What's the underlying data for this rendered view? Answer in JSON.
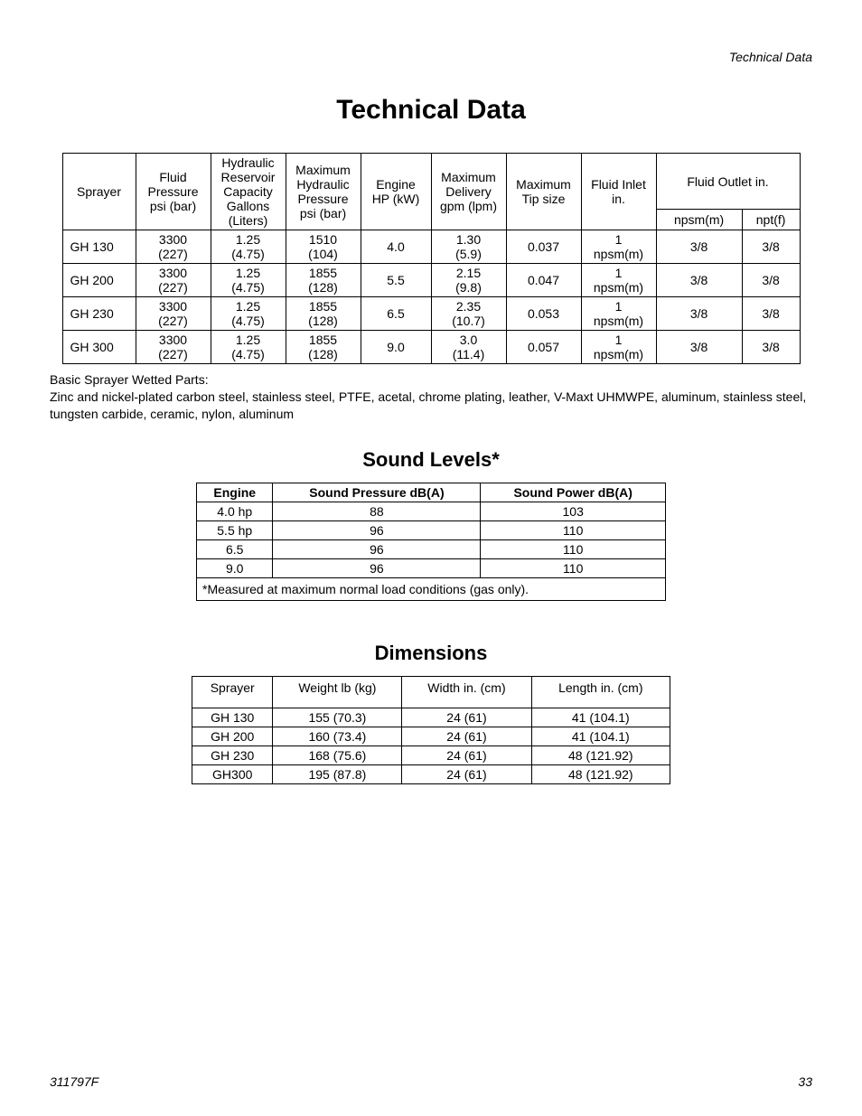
{
  "running_head": "Technical Data",
  "title": "Technical Data",
  "tech_table": {
    "headers": {
      "sprayer": "Sprayer",
      "fluid_pressure": "Fluid Pressure psi (bar)",
      "reservoir": "Hydraulic Reservoir Capacity Gallons (Liters)",
      "max_hyd": "Maximum Hydraulic Pressure psi (bar)",
      "engine": "Engine HP (kW)",
      "max_delivery": "Maximum Delivery gpm (lpm)",
      "tip": "Maximum Tip size",
      "inlet": "Fluid Inlet in.",
      "outlet": "Fluid Outlet in.",
      "outlet_sub_a": "npsm(m)",
      "outlet_sub_b": "npt(f)"
    },
    "rows": [
      {
        "model": "GH 130",
        "fp_a": "3300",
        "fp_b": "(227)",
        "res_a": "1.25",
        "res_b": "(4.75)",
        "mh_a": "1510",
        "mh_b": "(104)",
        "eng": "4.0",
        "md_a": "1.30",
        "md_b": "(5.9)",
        "tip": "0.037",
        "in_a": "1",
        "in_b": "npsm(m)",
        "out_a": "3/8",
        "out_b": "3/8"
      },
      {
        "model": "GH 200",
        "fp_a": "3300",
        "fp_b": "(227)",
        "res_a": "1.25",
        "res_b": "(4.75)",
        "mh_a": "1855",
        "mh_b": "(128)",
        "eng": "5.5",
        "md_a": "2.15",
        "md_b": "(9.8)",
        "tip": "0.047",
        "in_a": "1",
        "in_b": "npsm(m)",
        "out_a": "3/8",
        "out_b": "3/8"
      },
      {
        "model": "GH 230",
        "fp_a": "3300",
        "fp_b": "(227)",
        "res_a": "1.25",
        "res_b": "(4.75)",
        "mh_a": "1855",
        "mh_b": "(128)",
        "eng": "6.5",
        "md_a": "2.35",
        "md_b": "(10.7)",
        "tip": "0.053",
        "in_a": "1",
        "in_b": "npsm(m)",
        "out_a": "3/8",
        "out_b": "3/8"
      },
      {
        "model": "GH 300",
        "fp_a": "3300",
        "fp_b": "(227)",
        "res_a": "1.25",
        "res_b": "(4.75)",
        "mh_a": "1855",
        "mh_b": "(128)",
        "eng": "9.0",
        "md_a": "3.0",
        "md_b": "(11.4)",
        "tip": "0.057",
        "in_a": "1",
        "in_b": "npsm(m)",
        "out_a": "3/8",
        "out_b": "3/8"
      }
    ]
  },
  "wetted_heading": "Basic Sprayer Wetted Parts:",
  "wetted_body": "Zinc and nickel-plated carbon steel, stainless steel, PTFE, acetal, chrome plating, leather, V-Maxt UHMWPE, aluminum, stainless steel, tungsten carbide, ceramic, nylon, aluminum",
  "sound": {
    "title": "Sound Levels*",
    "headers": {
      "engine": "Engine",
      "pressure": "Sound Pressure dB(A)",
      "power": "Sound Power dB(A)"
    },
    "rows": [
      {
        "engine": "4.0 hp",
        "pressure": "88",
        "power": "103"
      },
      {
        "engine": "5.5 hp",
        "pressure": "96",
        "power": "110"
      },
      {
        "engine": "6.5",
        "pressure": "96",
        "power": "110"
      },
      {
        "engine": "9.0",
        "pressure": "96",
        "power": "110"
      }
    ],
    "note": "*Measured at maximum normal load conditions (gas only)."
  },
  "dimensions": {
    "title": "Dimensions",
    "headers": {
      "sprayer": "Sprayer",
      "weight": "Weight lb (kg)",
      "width": "Width in. (cm)",
      "length": "Length in. (cm)"
    },
    "rows": [
      {
        "sprayer": "GH 130",
        "weight": "155 (70.3)",
        "width": "24 (61)",
        "length": "41 (104.1)"
      },
      {
        "sprayer": "GH 200",
        "weight": "160 (73.4)",
        "width": "24 (61)",
        "length": "41 (104.1)"
      },
      {
        "sprayer": "GH 230",
        "weight": "168 (75.6)",
        "width": "24 (61)",
        "length": "48 (121.92)"
      },
      {
        "sprayer": "GH300",
        "weight": "195 (87.8)",
        "width": "24 (61)",
        "length": "48 (121.92)"
      }
    ]
  },
  "footer_left": "311797F",
  "footer_right": "33"
}
